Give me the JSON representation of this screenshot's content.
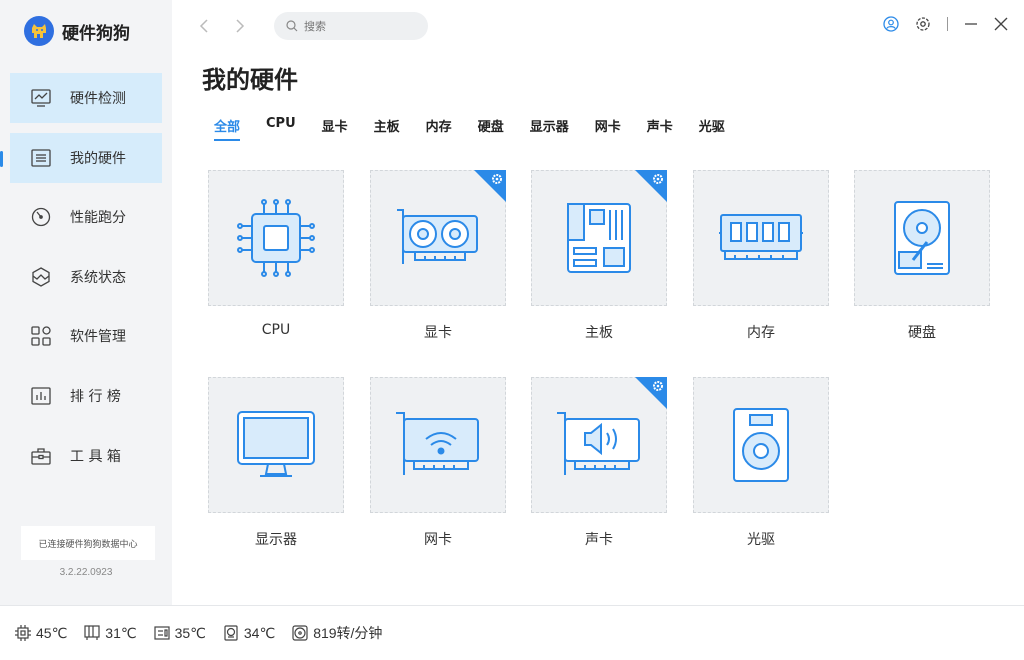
{
  "app": {
    "title": "硬件狗狗",
    "version": "3.2.22.0923",
    "connection_status": "已连接硬件狗狗数据中心"
  },
  "sidebar": {
    "items": [
      {
        "label": "硬件检测",
        "icon": "monitor-chart-icon",
        "state": "highlighted"
      },
      {
        "label": "我的硬件",
        "icon": "chip-list-icon",
        "state": "selected"
      },
      {
        "label": "性能跑分",
        "icon": "speedometer-icon",
        "state": "normal"
      },
      {
        "label": "系统状态",
        "icon": "cube-icon",
        "state": "normal"
      },
      {
        "label": "软件管理",
        "icon": "apps-grid-icon",
        "state": "normal"
      },
      {
        "label": "排 行 榜",
        "icon": "ranking-chart-icon",
        "state": "normal"
      },
      {
        "label": "工 具 箱",
        "icon": "toolbox-icon",
        "state": "normal"
      }
    ]
  },
  "search": {
    "placeholder": "搜索",
    "value": ""
  },
  "main": {
    "title": "我的硬件",
    "tabs": [
      "全部",
      "CPU",
      "显卡",
      "主板",
      "内存",
      "硬盘",
      "显示器",
      "网卡",
      "声卡",
      "光驱"
    ],
    "active_tab": "全部",
    "cards": [
      {
        "label": "CPU",
        "icon": "cpu-icon",
        "badge": false
      },
      {
        "label": "显卡",
        "icon": "graphics-card-icon",
        "badge": true
      },
      {
        "label": "主板",
        "icon": "motherboard-icon",
        "badge": true
      },
      {
        "label": "内存",
        "icon": "memory-icon",
        "badge": false
      },
      {
        "label": "硬盘",
        "icon": "hard-disk-icon",
        "badge": false
      },
      {
        "label": "显示器",
        "icon": "monitor-icon",
        "badge": false
      },
      {
        "label": "网卡",
        "icon": "network-card-icon",
        "badge": false
      },
      {
        "label": "声卡",
        "icon": "sound-card-icon",
        "badge": true
      },
      {
        "label": "光驱",
        "icon": "optical-drive-icon",
        "badge": false
      }
    ]
  },
  "status_bar": {
    "cpu_temp": "45℃",
    "gpu_temp": "31℃",
    "board_temp": "35℃",
    "disk_temp": "34℃",
    "fan_speed": "819转/分钟"
  },
  "colors": {
    "accent": "#2b8ae8",
    "sidebar_bg": "#f3f4f6",
    "nav_highlight": "#d6ecfb",
    "tile_bg": "#eff1f3",
    "icon_fill": "#d8ebfb"
  }
}
